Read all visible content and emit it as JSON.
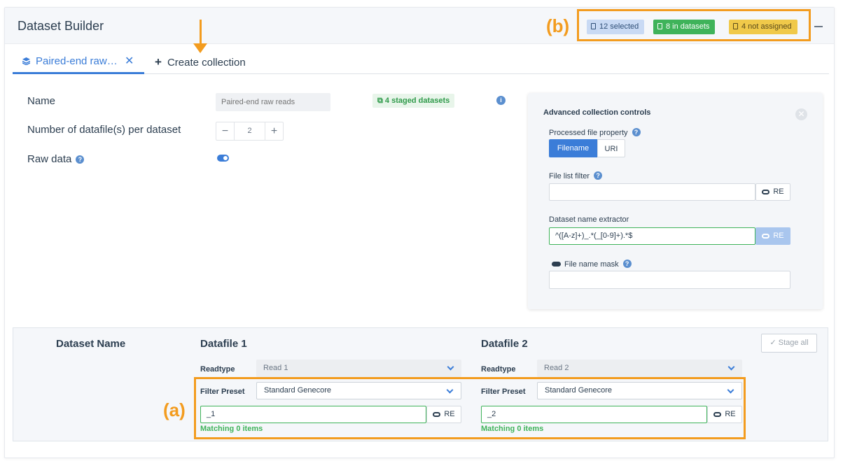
{
  "header": {
    "title": "Dataset Builder",
    "badges": {
      "selected": "12 selected",
      "in_datasets": "8 in datasets",
      "not_assigned": "4 not assigned"
    }
  },
  "annotations": {
    "a": "(a)",
    "b": "(b)"
  },
  "tabs": {
    "active": "Paired-end raw…",
    "create": "Create collection"
  },
  "form": {
    "name_label": "Name",
    "name_placeholder": "Paired-end raw reads",
    "staged_badge": "4 staged datasets",
    "datafiles_label": "Number of datafile(s) per dataset",
    "datafiles_value": "2",
    "raw_label": "Raw data",
    "raw_enabled": true
  },
  "advanced": {
    "title": "Advanced collection controls",
    "processed_label": "Processed file property",
    "segments": [
      "Filename",
      "URI"
    ],
    "selected_segment": "Filename",
    "filter_label": "File list filter",
    "filter_value": "",
    "extractor_label": "Dataset name extractor",
    "extractor_value": "^([A-z]+)_.*(_[0-9]+).*$",
    "mask_label": "File name mask",
    "mask_value": "",
    "re_label": "RE"
  },
  "table": {
    "dataset_name_header": "Dataset Name",
    "stage_all": "Stage all",
    "readtype_label": "Readtype",
    "filter_preset_label": "Filter Preset",
    "columns": [
      {
        "header": "Datafile 1",
        "readtype": "Read 1",
        "preset": "Standard Genecore",
        "pattern": "_1",
        "match": "Matching 0 items"
      },
      {
        "header": "Datafile 2",
        "readtype": "Read 2",
        "preset": "Standard Genecore",
        "pattern": "_2",
        "match": "Matching 0 items"
      }
    ]
  },
  "colors": {
    "accent": "#3b7dd8",
    "success": "#3fb35a",
    "warning": "#f0c94a",
    "annotation": "#f39c1f"
  }
}
